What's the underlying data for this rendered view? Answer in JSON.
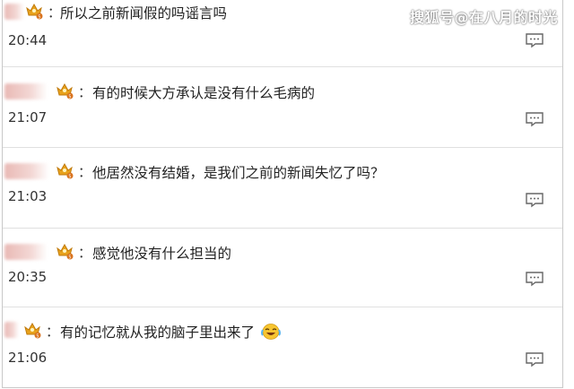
{
  "watermark": "搜狐号@在八月的时光",
  "colors": {
    "crown": "#e8a21c",
    "crown_badge": "#d9731e",
    "blur_name": "#e9b9b5"
  },
  "comments": [
    {
      "text": "所以之前新闻假的吗谣言吗",
      "time": "20:44",
      "colon": "："
    },
    {
      "text": "有的时候大方承认是没有什么毛病的",
      "time": "21:07",
      "colon": "："
    },
    {
      "text": "他居然没有结婚，是我们之前的新闻失忆了吗？",
      "time": "21:03",
      "colon": "："
    },
    {
      "text": "感觉他没有什么担当的",
      "time": "20:35",
      "colon": "："
    },
    {
      "text": "有的记忆就从我的脑子里出来了",
      "time": "21:06",
      "colon": "：",
      "emoji": "laughing-tears-emoji"
    }
  ]
}
